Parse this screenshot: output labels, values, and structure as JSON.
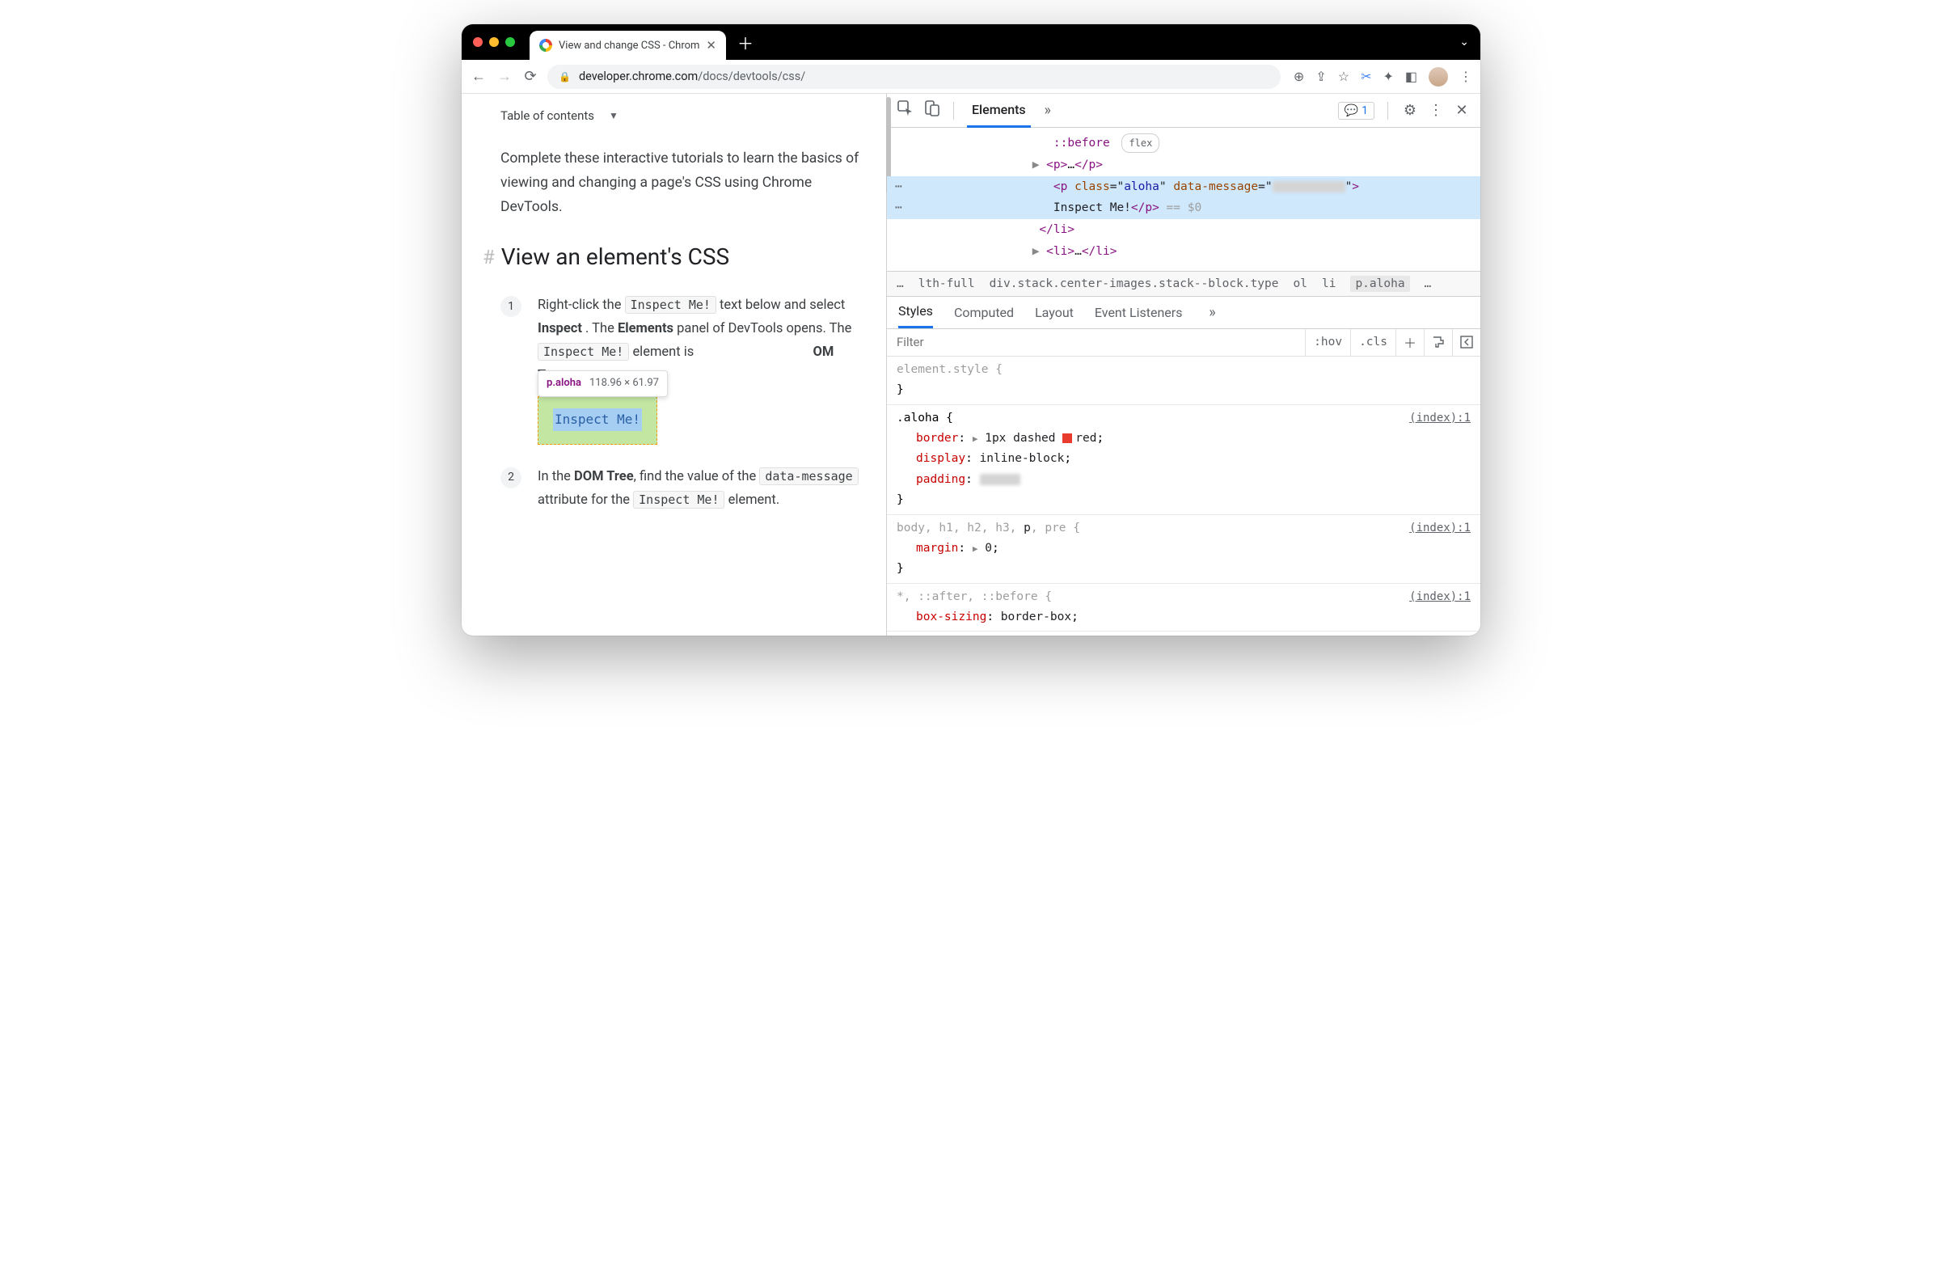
{
  "browser": {
    "tab_title": "View and change CSS - Chrom",
    "url_host": "developer.chrome.com",
    "url_path": "/docs/devtools/css/"
  },
  "page": {
    "toc_label": "Table of contents",
    "intro": "Complete these interactive tutorials to learn the basics of viewing and changing a page's CSS using Chrome DevTools.",
    "heading": "View an element's CSS",
    "step1_a": "Right-click the ",
    "step1_code1": "Inspect Me!",
    "step1_b": " text below and select ",
    "step1_bold1": "Inspect",
    "step1_c": ". The ",
    "step1_bold2": "Elements",
    "step1_d": " panel of DevTools opens. The ",
    "step1_code2": "Inspect Me!",
    "step1_e": " element is",
    "step1_trail_bold": "OM Tree",
    "step1_trail_dot": ".",
    "tooltip_selector": "p.aloha",
    "tooltip_dims": "118.96 × 61.97",
    "inspect_target": "Inspect Me!",
    "step2_a": "In the ",
    "step2_bold": "DOM Tree",
    "step2_b": ", find the value of the ",
    "step2_code1": "data-message",
    "step2_c": " attribute for the ",
    "step2_code2": "Inspect Me!",
    "step2_d": " element."
  },
  "devtools": {
    "main_tab": "Elements",
    "badge_count": "1",
    "dom": {
      "before": "::before",
      "flex_badge": "flex",
      "p_collapsed": "<p>…</p>",
      "sel_open": "<p class=\"aloha\" data-message=\"",
      "sel_close": "\">",
      "sel_text": "Inspect Me!",
      "sel_end": "</p>",
      "eq0": " == $0",
      "li_close": "</li>",
      "li_collapsed": "<li>…</li>"
    },
    "breadcrumb": {
      "truncated": "lth-full",
      "div": "div.stack.center-images.stack--block.type",
      "ol": "ol",
      "li": "li",
      "sel": "p.aloha"
    },
    "subtabs": [
      "Styles",
      "Computed",
      "Layout",
      "Event Listeners"
    ],
    "filter_placeholder": "Filter",
    "hov": ":hov",
    "cls": ".cls",
    "rules": {
      "r0_sel": "element.style {",
      "r1_sel": ".aloha {",
      "r1_src": "(index):1",
      "r1_p1_name": "border",
      "r1_p1_val": "1px dashed ",
      "r1_p1_color": "red",
      "r1_p2_name": "display",
      "r1_p2_val": "inline-block",
      "r1_p3_name": "padding",
      "r2_sel_pre": "body, h1, h2, h3, ",
      "r2_sel_em": "p",
      "r2_sel_post": ", pre {",
      "r2_src": "(index):1",
      "r2_p1_name": "margin",
      "r2_p1_val": "0",
      "r3_sel": "*, ::after, ::before {",
      "r3_src": "(index):1",
      "r3_p1_name": "box-sizing",
      "r3_p1_val": "border-box"
    }
  }
}
